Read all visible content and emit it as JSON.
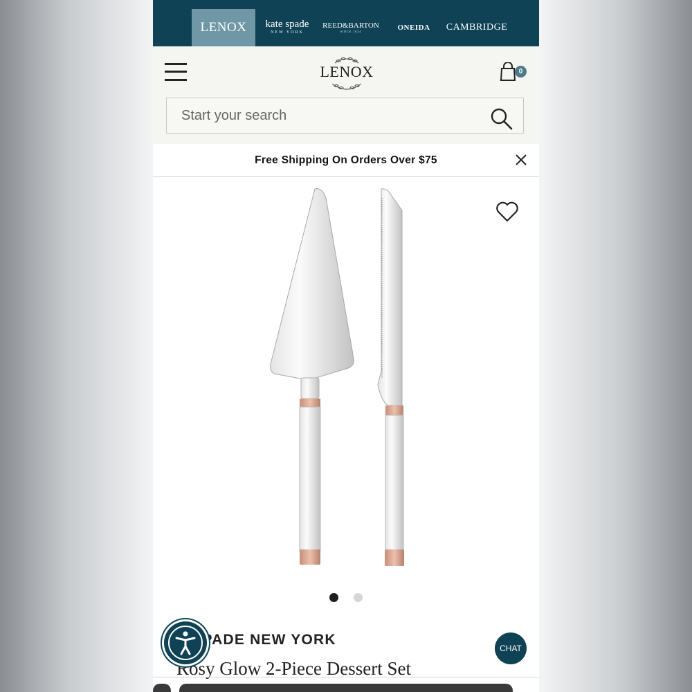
{
  "brand_bar": {
    "lenox": "LENOX",
    "kate_spade": "kate spade",
    "kate_spade_sub": "NEW YORK",
    "reed_barton": "REED&BARTON",
    "reed_barton_sub": "SINCE 1824",
    "oneida": "ONEIDA",
    "cambridge": "CAMBRIDGE"
  },
  "header": {
    "logo": "LENOX",
    "cart_count": "0",
    "search_placeholder": "Start your search"
  },
  "promo": {
    "text": "Free Shipping On Orders Over $75"
  },
  "product": {
    "carousel_total": 2,
    "carousel_active": 1,
    "brand": "E SPADE NEW YORK",
    "title": "Rosy Glow 2-Piece Dessert Set"
  },
  "chat": {
    "label": "CHAT"
  },
  "colors": {
    "brand_bar": "#0e4254",
    "brand_active": "#6f97a6",
    "header_bg": "#f5f5f2",
    "rose_gold": "#d7a08b",
    "cart_badge": "#4e7a8a"
  }
}
